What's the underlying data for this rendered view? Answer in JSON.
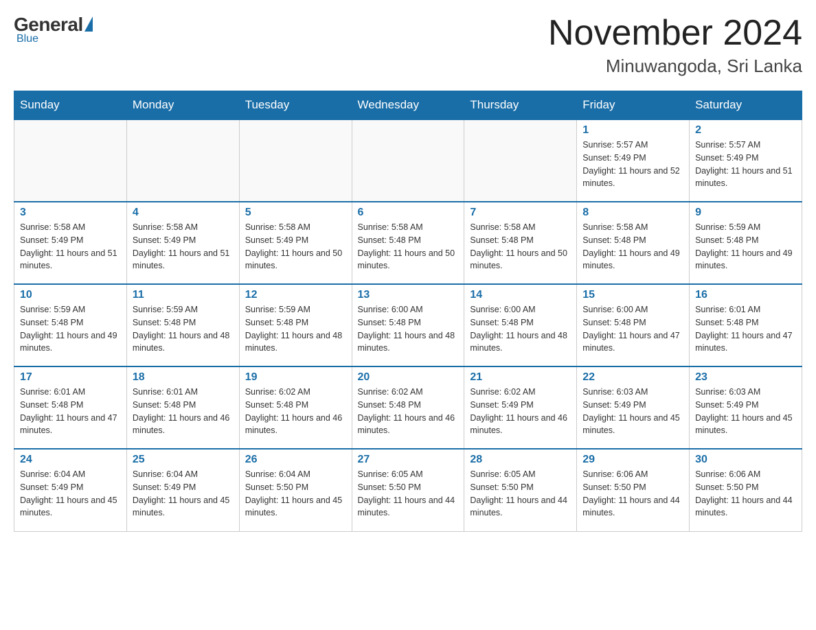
{
  "header": {
    "logo": {
      "general": "General",
      "blue": "Blue"
    },
    "title": "November 2024",
    "location": "Minuwangoda, Sri Lanka"
  },
  "weekdays": [
    "Sunday",
    "Monday",
    "Tuesday",
    "Wednesday",
    "Thursday",
    "Friday",
    "Saturday"
  ],
  "weeks": [
    [
      {
        "day": "",
        "sunrise": "",
        "sunset": "",
        "daylight": ""
      },
      {
        "day": "",
        "sunrise": "",
        "sunset": "",
        "daylight": ""
      },
      {
        "day": "",
        "sunrise": "",
        "sunset": "",
        "daylight": ""
      },
      {
        "day": "",
        "sunrise": "",
        "sunset": "",
        "daylight": ""
      },
      {
        "day": "",
        "sunrise": "",
        "sunset": "",
        "daylight": ""
      },
      {
        "day": "1",
        "sunrise": "Sunrise: 5:57 AM",
        "sunset": "Sunset: 5:49 PM",
        "daylight": "Daylight: 11 hours and 52 minutes."
      },
      {
        "day": "2",
        "sunrise": "Sunrise: 5:57 AM",
        "sunset": "Sunset: 5:49 PM",
        "daylight": "Daylight: 11 hours and 51 minutes."
      }
    ],
    [
      {
        "day": "3",
        "sunrise": "Sunrise: 5:58 AM",
        "sunset": "Sunset: 5:49 PM",
        "daylight": "Daylight: 11 hours and 51 minutes."
      },
      {
        "day": "4",
        "sunrise": "Sunrise: 5:58 AM",
        "sunset": "Sunset: 5:49 PM",
        "daylight": "Daylight: 11 hours and 51 minutes."
      },
      {
        "day": "5",
        "sunrise": "Sunrise: 5:58 AM",
        "sunset": "Sunset: 5:49 PM",
        "daylight": "Daylight: 11 hours and 50 minutes."
      },
      {
        "day": "6",
        "sunrise": "Sunrise: 5:58 AM",
        "sunset": "Sunset: 5:48 PM",
        "daylight": "Daylight: 11 hours and 50 minutes."
      },
      {
        "day": "7",
        "sunrise": "Sunrise: 5:58 AM",
        "sunset": "Sunset: 5:48 PM",
        "daylight": "Daylight: 11 hours and 50 minutes."
      },
      {
        "day": "8",
        "sunrise": "Sunrise: 5:58 AM",
        "sunset": "Sunset: 5:48 PM",
        "daylight": "Daylight: 11 hours and 49 minutes."
      },
      {
        "day": "9",
        "sunrise": "Sunrise: 5:59 AM",
        "sunset": "Sunset: 5:48 PM",
        "daylight": "Daylight: 11 hours and 49 minutes."
      }
    ],
    [
      {
        "day": "10",
        "sunrise": "Sunrise: 5:59 AM",
        "sunset": "Sunset: 5:48 PM",
        "daylight": "Daylight: 11 hours and 49 minutes."
      },
      {
        "day": "11",
        "sunrise": "Sunrise: 5:59 AM",
        "sunset": "Sunset: 5:48 PM",
        "daylight": "Daylight: 11 hours and 48 minutes."
      },
      {
        "day": "12",
        "sunrise": "Sunrise: 5:59 AM",
        "sunset": "Sunset: 5:48 PM",
        "daylight": "Daylight: 11 hours and 48 minutes."
      },
      {
        "day": "13",
        "sunrise": "Sunrise: 6:00 AM",
        "sunset": "Sunset: 5:48 PM",
        "daylight": "Daylight: 11 hours and 48 minutes."
      },
      {
        "day": "14",
        "sunrise": "Sunrise: 6:00 AM",
        "sunset": "Sunset: 5:48 PM",
        "daylight": "Daylight: 11 hours and 48 minutes."
      },
      {
        "day": "15",
        "sunrise": "Sunrise: 6:00 AM",
        "sunset": "Sunset: 5:48 PM",
        "daylight": "Daylight: 11 hours and 47 minutes."
      },
      {
        "day": "16",
        "sunrise": "Sunrise: 6:01 AM",
        "sunset": "Sunset: 5:48 PM",
        "daylight": "Daylight: 11 hours and 47 minutes."
      }
    ],
    [
      {
        "day": "17",
        "sunrise": "Sunrise: 6:01 AM",
        "sunset": "Sunset: 5:48 PM",
        "daylight": "Daylight: 11 hours and 47 minutes."
      },
      {
        "day": "18",
        "sunrise": "Sunrise: 6:01 AM",
        "sunset": "Sunset: 5:48 PM",
        "daylight": "Daylight: 11 hours and 46 minutes."
      },
      {
        "day": "19",
        "sunrise": "Sunrise: 6:02 AM",
        "sunset": "Sunset: 5:48 PM",
        "daylight": "Daylight: 11 hours and 46 minutes."
      },
      {
        "day": "20",
        "sunrise": "Sunrise: 6:02 AM",
        "sunset": "Sunset: 5:48 PM",
        "daylight": "Daylight: 11 hours and 46 minutes."
      },
      {
        "day": "21",
        "sunrise": "Sunrise: 6:02 AM",
        "sunset": "Sunset: 5:49 PM",
        "daylight": "Daylight: 11 hours and 46 minutes."
      },
      {
        "day": "22",
        "sunrise": "Sunrise: 6:03 AM",
        "sunset": "Sunset: 5:49 PM",
        "daylight": "Daylight: 11 hours and 45 minutes."
      },
      {
        "day": "23",
        "sunrise": "Sunrise: 6:03 AM",
        "sunset": "Sunset: 5:49 PM",
        "daylight": "Daylight: 11 hours and 45 minutes."
      }
    ],
    [
      {
        "day": "24",
        "sunrise": "Sunrise: 6:04 AM",
        "sunset": "Sunset: 5:49 PM",
        "daylight": "Daylight: 11 hours and 45 minutes."
      },
      {
        "day": "25",
        "sunrise": "Sunrise: 6:04 AM",
        "sunset": "Sunset: 5:49 PM",
        "daylight": "Daylight: 11 hours and 45 minutes."
      },
      {
        "day": "26",
        "sunrise": "Sunrise: 6:04 AM",
        "sunset": "Sunset: 5:50 PM",
        "daylight": "Daylight: 11 hours and 45 minutes."
      },
      {
        "day": "27",
        "sunrise": "Sunrise: 6:05 AM",
        "sunset": "Sunset: 5:50 PM",
        "daylight": "Daylight: 11 hours and 44 minutes."
      },
      {
        "day": "28",
        "sunrise": "Sunrise: 6:05 AM",
        "sunset": "Sunset: 5:50 PM",
        "daylight": "Daylight: 11 hours and 44 minutes."
      },
      {
        "day": "29",
        "sunrise": "Sunrise: 6:06 AM",
        "sunset": "Sunset: 5:50 PM",
        "daylight": "Daylight: 11 hours and 44 minutes."
      },
      {
        "day": "30",
        "sunrise": "Sunrise: 6:06 AM",
        "sunset": "Sunset: 5:50 PM",
        "daylight": "Daylight: 11 hours and 44 minutes."
      }
    ]
  ]
}
